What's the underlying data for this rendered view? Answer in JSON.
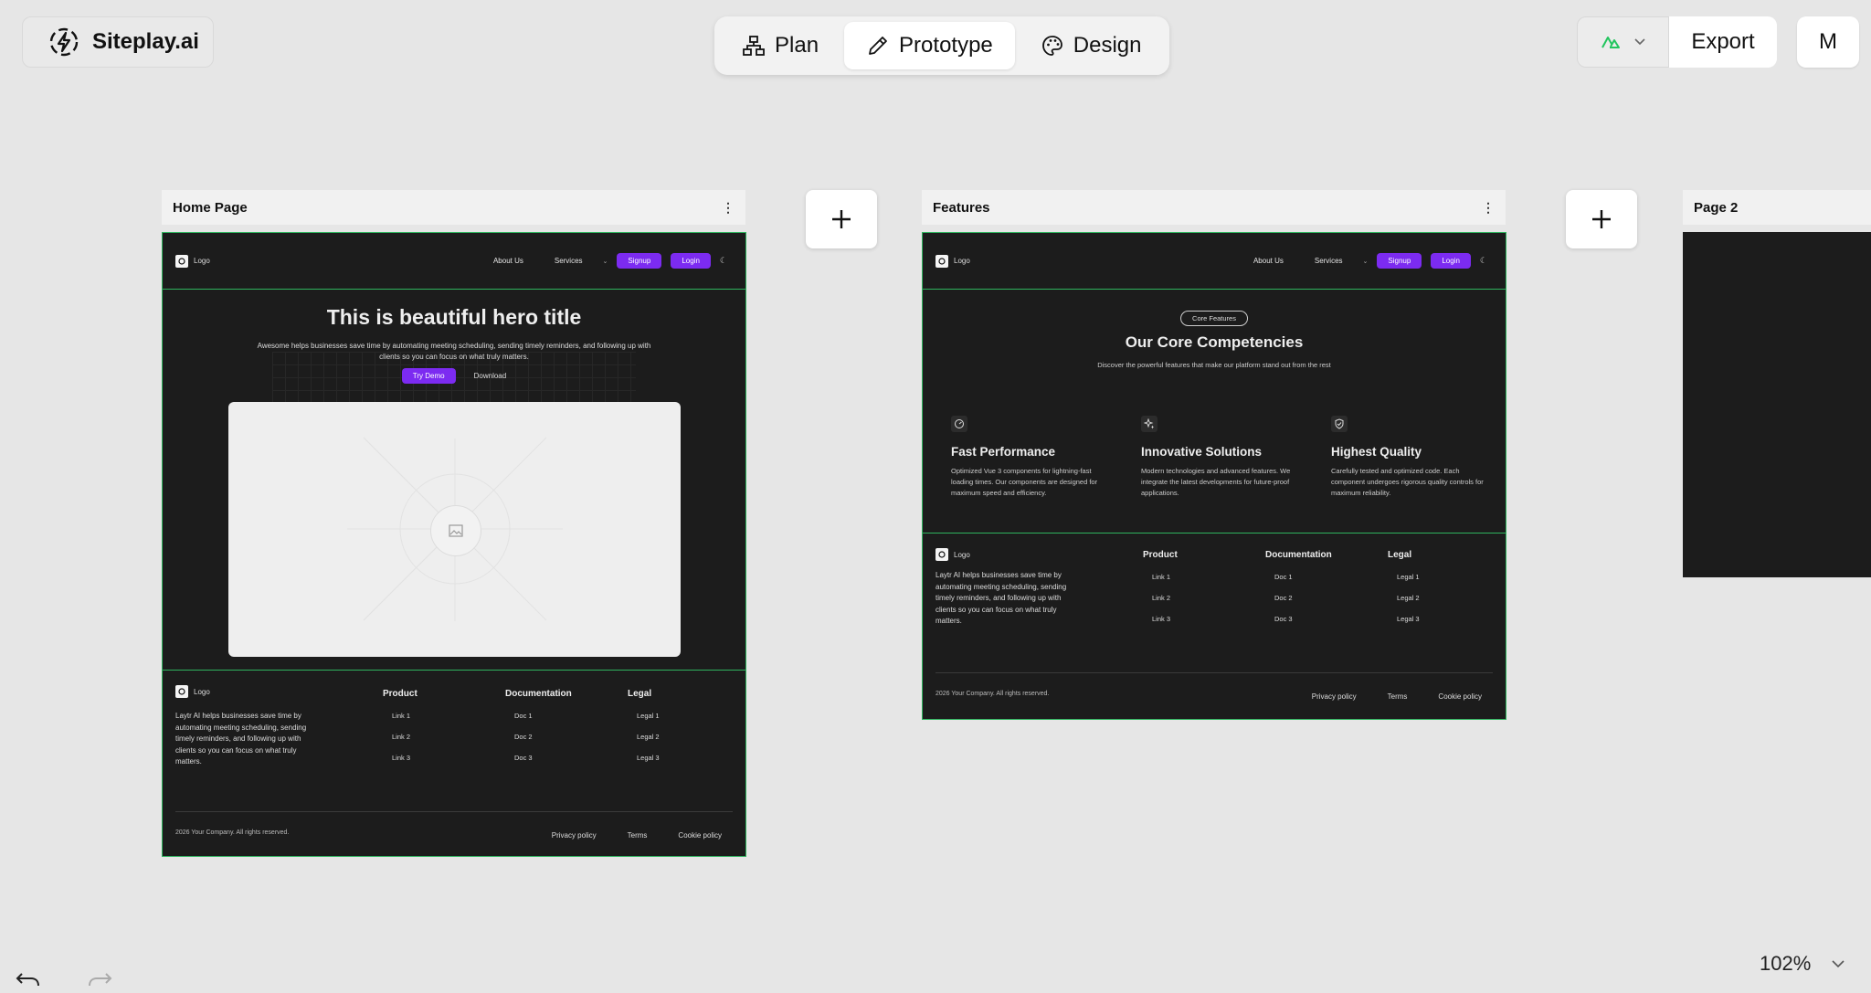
{
  "app": {
    "brand": "Siteplay.ai"
  },
  "modes": [
    {
      "label": "Plan",
      "active": false
    },
    {
      "label": "Prototype",
      "active": true
    },
    {
      "label": "Design",
      "active": false
    }
  ],
  "toolbar": {
    "export_label": "Export",
    "avatar_initial": "M",
    "framework_icon": "nuxt-icon"
  },
  "canvas_zoom": "102%",
  "pages": [
    {
      "title": "Home Page",
      "nav": {
        "logo": "Logo",
        "links": [
          "About Us",
          "Services"
        ],
        "signup": "Signup",
        "login": "Login"
      },
      "hero": {
        "title": "This is beautiful hero title",
        "subtitle": "Awesome helps businesses save time by automating meeting scheduling, sending timely reminders, and following up with clients so you can focus on what truly matters.",
        "primary_cta": "Try Demo",
        "secondary_cta": "Download"
      },
      "footer": {
        "logo": "Logo",
        "description": "Laytr AI helps businesses save time by automating meeting scheduling, sending timely reminders, and following up with clients so you can focus on what truly matters.",
        "columns": [
          {
            "heading": "Product",
            "links": [
              "Link 1",
              "Link 2",
              "Link 3"
            ]
          },
          {
            "heading": "Documentation",
            "links": [
              "Doc 1",
              "Doc 2",
              "Doc 3"
            ]
          },
          {
            "heading": "Legal",
            "links": [
              "Legal 1",
              "Legal 2",
              "Legal 3"
            ]
          }
        ],
        "copyright": "2026 Your Company. All rights reserved.",
        "bottom_links": [
          "Privacy policy",
          "Terms",
          "Cookie policy"
        ]
      }
    },
    {
      "title": "Features",
      "nav": {
        "logo": "Logo",
        "links": [
          "About Us",
          "Services"
        ],
        "signup": "Signup",
        "login": "Login"
      },
      "section": {
        "badge": "Core Features",
        "title": "Our Core Competencies",
        "subtitle": "Discover the powerful features that make our platform stand out from the rest",
        "cards": [
          {
            "icon": "gauge-icon",
            "title": "Fast Performance",
            "text": "Optimized Vue 3 components for lightning-fast loading times. Our components are designed for maximum speed and efficiency."
          },
          {
            "icon": "sparkles-icon",
            "title": "Innovative Solutions",
            "text": "Modern technologies and advanced features. We integrate the latest developments for future-proof applications."
          },
          {
            "icon": "shield-check-icon",
            "title": "Highest Quality",
            "text": "Carefully tested and optimized code. Each component undergoes rigorous quality controls for maximum reliability."
          }
        ]
      },
      "footer": {
        "logo": "Logo",
        "description": "Laytr AI helps businesses save time by automating meeting scheduling, sending timely reminders, and following up with clients so you can focus on what truly matters.",
        "columns": [
          {
            "heading": "Product",
            "links": [
              "Link 1",
              "Link 2",
              "Link 3"
            ]
          },
          {
            "heading": "Documentation",
            "links": [
              "Doc 1",
              "Doc 2",
              "Doc 3"
            ]
          },
          {
            "heading": "Legal",
            "links": [
              "Legal 1",
              "Legal 2",
              "Legal 3"
            ]
          }
        ],
        "copyright": "2026 Your Company. All rights reserved.",
        "bottom_links": [
          "Privacy policy",
          "Terms",
          "Cookie policy"
        ]
      }
    },
    {
      "title": "Page 2"
    }
  ]
}
